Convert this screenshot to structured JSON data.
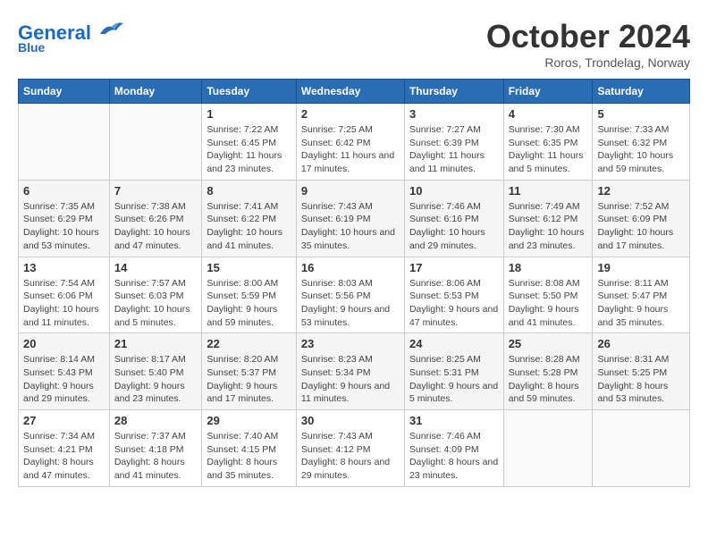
{
  "header": {
    "logo_line1": "General",
    "logo_line2": "Blue",
    "month": "October 2024",
    "location": "Roros, Trondelag, Norway"
  },
  "weekdays": [
    "Sunday",
    "Monday",
    "Tuesday",
    "Wednesday",
    "Thursday",
    "Friday",
    "Saturday"
  ],
  "weeks": [
    [
      {
        "day": "",
        "detail": ""
      },
      {
        "day": "",
        "detail": ""
      },
      {
        "day": "1",
        "detail": "Sunrise: 7:22 AM\nSunset: 6:45 PM\nDaylight: 11 hours\nand 23 minutes."
      },
      {
        "day": "2",
        "detail": "Sunrise: 7:25 AM\nSunset: 6:42 PM\nDaylight: 11 hours\nand 17 minutes."
      },
      {
        "day": "3",
        "detail": "Sunrise: 7:27 AM\nSunset: 6:39 PM\nDaylight: 11 hours\nand 11 minutes."
      },
      {
        "day": "4",
        "detail": "Sunrise: 7:30 AM\nSunset: 6:35 PM\nDaylight: 11 hours\nand 5 minutes."
      },
      {
        "day": "5",
        "detail": "Sunrise: 7:33 AM\nSunset: 6:32 PM\nDaylight: 10 hours\nand 59 minutes."
      }
    ],
    [
      {
        "day": "6",
        "detail": "Sunrise: 7:35 AM\nSunset: 6:29 PM\nDaylight: 10 hours\nand 53 minutes."
      },
      {
        "day": "7",
        "detail": "Sunrise: 7:38 AM\nSunset: 6:26 PM\nDaylight: 10 hours\nand 47 minutes."
      },
      {
        "day": "8",
        "detail": "Sunrise: 7:41 AM\nSunset: 6:22 PM\nDaylight: 10 hours\nand 41 minutes."
      },
      {
        "day": "9",
        "detail": "Sunrise: 7:43 AM\nSunset: 6:19 PM\nDaylight: 10 hours\nand 35 minutes."
      },
      {
        "day": "10",
        "detail": "Sunrise: 7:46 AM\nSunset: 6:16 PM\nDaylight: 10 hours\nand 29 minutes."
      },
      {
        "day": "11",
        "detail": "Sunrise: 7:49 AM\nSunset: 6:12 PM\nDaylight: 10 hours\nand 23 minutes."
      },
      {
        "day": "12",
        "detail": "Sunrise: 7:52 AM\nSunset: 6:09 PM\nDaylight: 10 hours\nand 17 minutes."
      }
    ],
    [
      {
        "day": "13",
        "detail": "Sunrise: 7:54 AM\nSunset: 6:06 PM\nDaylight: 10 hours\nand 11 minutes."
      },
      {
        "day": "14",
        "detail": "Sunrise: 7:57 AM\nSunset: 6:03 PM\nDaylight: 10 hours\nand 5 minutes."
      },
      {
        "day": "15",
        "detail": "Sunrise: 8:00 AM\nSunset: 5:59 PM\nDaylight: 9 hours\nand 59 minutes."
      },
      {
        "day": "16",
        "detail": "Sunrise: 8:03 AM\nSunset: 5:56 PM\nDaylight: 9 hours\nand 53 minutes."
      },
      {
        "day": "17",
        "detail": "Sunrise: 8:06 AM\nSunset: 5:53 PM\nDaylight: 9 hours\nand 47 minutes."
      },
      {
        "day": "18",
        "detail": "Sunrise: 8:08 AM\nSunset: 5:50 PM\nDaylight: 9 hours\nand 41 minutes."
      },
      {
        "day": "19",
        "detail": "Sunrise: 8:11 AM\nSunset: 5:47 PM\nDaylight: 9 hours\nand 35 minutes."
      }
    ],
    [
      {
        "day": "20",
        "detail": "Sunrise: 8:14 AM\nSunset: 5:43 PM\nDaylight: 9 hours\nand 29 minutes."
      },
      {
        "day": "21",
        "detail": "Sunrise: 8:17 AM\nSunset: 5:40 PM\nDaylight: 9 hours\nand 23 minutes."
      },
      {
        "day": "22",
        "detail": "Sunrise: 8:20 AM\nSunset: 5:37 PM\nDaylight: 9 hours\nand 17 minutes."
      },
      {
        "day": "23",
        "detail": "Sunrise: 8:23 AM\nSunset: 5:34 PM\nDaylight: 9 hours\nand 11 minutes."
      },
      {
        "day": "24",
        "detail": "Sunrise: 8:25 AM\nSunset: 5:31 PM\nDaylight: 9 hours\nand 5 minutes."
      },
      {
        "day": "25",
        "detail": "Sunrise: 8:28 AM\nSunset: 5:28 PM\nDaylight: 8 hours\nand 59 minutes."
      },
      {
        "day": "26",
        "detail": "Sunrise: 8:31 AM\nSunset: 5:25 PM\nDaylight: 8 hours\nand 53 minutes."
      }
    ],
    [
      {
        "day": "27",
        "detail": "Sunrise: 7:34 AM\nSunset: 4:21 PM\nDaylight: 8 hours\nand 47 minutes."
      },
      {
        "day": "28",
        "detail": "Sunrise: 7:37 AM\nSunset: 4:18 PM\nDaylight: 8 hours\nand 41 minutes."
      },
      {
        "day": "29",
        "detail": "Sunrise: 7:40 AM\nSunset: 4:15 PM\nDaylight: 8 hours\nand 35 minutes."
      },
      {
        "day": "30",
        "detail": "Sunrise: 7:43 AM\nSunset: 4:12 PM\nDaylight: 8 hours\nand 29 minutes."
      },
      {
        "day": "31",
        "detail": "Sunrise: 7:46 AM\nSunset: 4:09 PM\nDaylight: 8 hours\nand 23 minutes."
      },
      {
        "day": "",
        "detail": ""
      },
      {
        "day": "",
        "detail": ""
      }
    ]
  ]
}
